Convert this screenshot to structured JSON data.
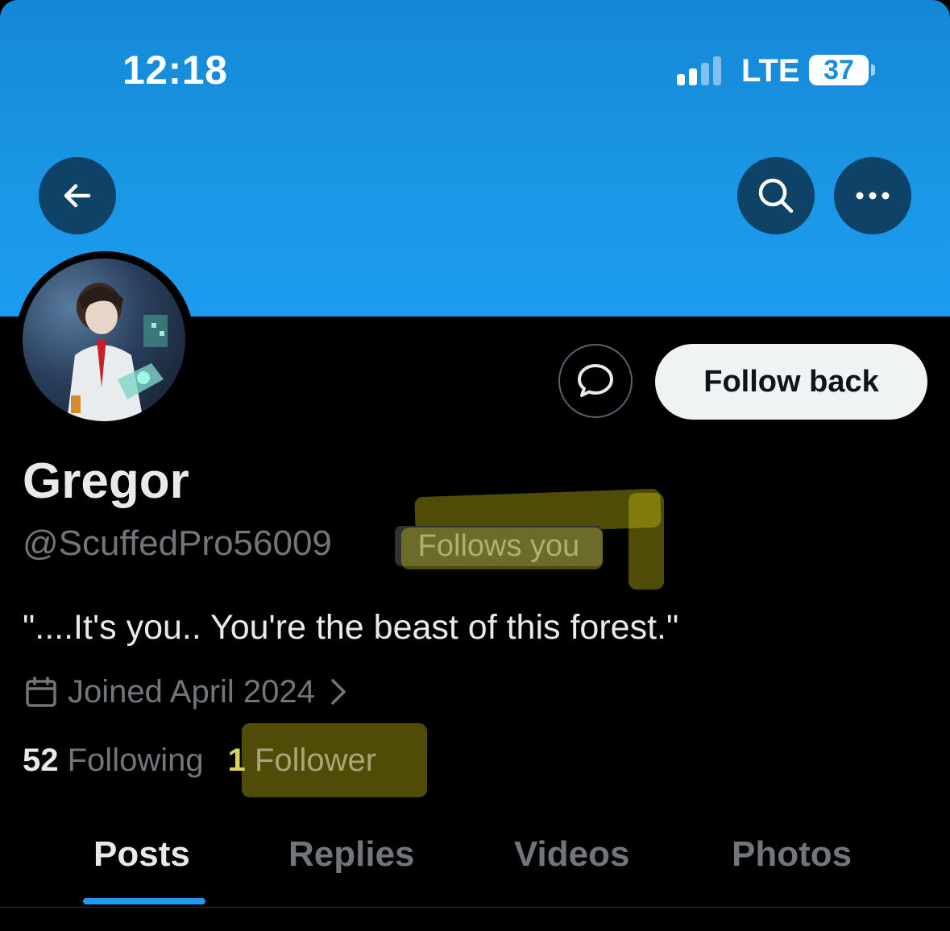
{
  "status_bar": {
    "time": "12:18",
    "network": "LTE",
    "battery": "37"
  },
  "header": {
    "back_icon": "arrow-left-icon",
    "search_icon": "search-icon",
    "more_icon": "more-horizontal-icon"
  },
  "profile": {
    "display_name": "Gregor",
    "handle": "@ScuffedPro56009",
    "follows_you_label": "Follows you",
    "bio": "\"....It's you.. You're the beast of this forest.\"",
    "joined": "Joined April 2024",
    "following_count": "52",
    "following_label": "Following",
    "follower_count": "1",
    "follower_label": "Follower"
  },
  "actions": {
    "message_icon": "message-bubble-icon",
    "follow_back_label": "Follow back"
  },
  "tabs": [
    {
      "label": "Posts",
      "active": true
    },
    {
      "label": "Replies",
      "active": false
    },
    {
      "label": "Videos",
      "active": false
    },
    {
      "label": "Photos",
      "active": false
    }
  ],
  "colors": {
    "banner": "#1d9bf0",
    "accent": "#1d9bf0",
    "highlight": "#d2c814",
    "background": "#000000"
  }
}
